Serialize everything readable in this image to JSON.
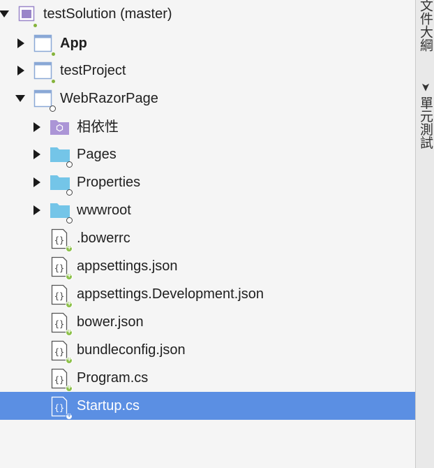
{
  "tree": {
    "solution": {
      "label": "testSolution (master)"
    },
    "projects": [
      {
        "label": "App"
      },
      {
        "label": "testProject"
      },
      {
        "label": "WebRazorPage"
      }
    ],
    "web_children": {
      "dependencies": {
        "label": "相依性"
      },
      "folders": [
        {
          "label": "Pages"
        },
        {
          "label": "Properties"
        },
        {
          "label": "wwwroot"
        }
      ],
      "files": [
        {
          "label": ".bowerrc"
        },
        {
          "label": "appsettings.json"
        },
        {
          "label": "appsettings.Development.json"
        },
        {
          "label": "bower.json"
        },
        {
          "label": "bundleconfig.json"
        },
        {
          "label": "Program.cs"
        },
        {
          "label": "Startup.cs"
        }
      ]
    },
    "selected_item": "Startup.cs"
  },
  "side_panel": {
    "tabs": [
      {
        "label": "文件大綱"
      },
      {
        "label": "單元測試"
      }
    ]
  },
  "colors": {
    "selection": "#5b8fe3",
    "folder": "#74c5e8",
    "project_icon": "#8aa8d6",
    "solution_icon": "#9a86c9",
    "dependency_icon": "#ab95d6",
    "added_badge": "#8dc14a"
  },
  "icons": [
    "solution-icon",
    "project-icon",
    "dependencies-icon",
    "folder-icon",
    "json-file-icon",
    "csharp-file-icon",
    "expand-arrow-icon",
    "collapse-arrow-icon"
  ]
}
